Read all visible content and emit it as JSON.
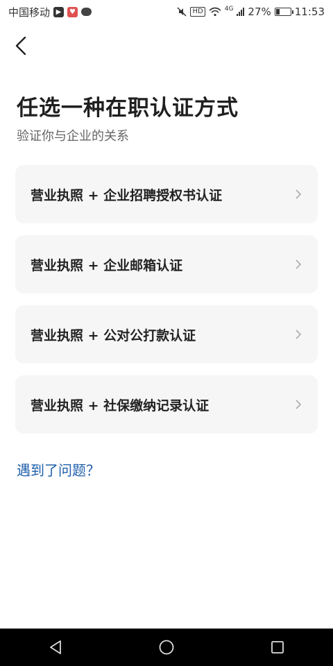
{
  "status_bar": {
    "carrier": "中国移动",
    "hd": "HD",
    "network": "4G",
    "battery_percent": "27%",
    "battery_level": 0.27,
    "time": "11:53"
  },
  "header": {
    "title": "任选一种在职认证方式",
    "subtitle": "验证你与企业的关系"
  },
  "options": [
    {
      "label": "营业执照 + 企业招聘授权书认证"
    },
    {
      "label": "营业执照 + 企业邮箱认证"
    },
    {
      "label": "营业执照 + 公对公打款认证"
    },
    {
      "label": "营业执照 + 社保缴纳记录认证"
    }
  ],
  "help": {
    "label": "遇到了问题？"
  },
  "icons": {
    "back": "back-arrow-icon",
    "chevron": "chevron-right-icon",
    "nav_back": "triangle-back-icon",
    "nav_home": "circle-home-icon",
    "nav_recent": "square-recent-icon"
  },
  "colors": {
    "accent_link": "#1e5eaa",
    "card_bg": "#f6f6f7",
    "nav_bar": "#000000"
  }
}
